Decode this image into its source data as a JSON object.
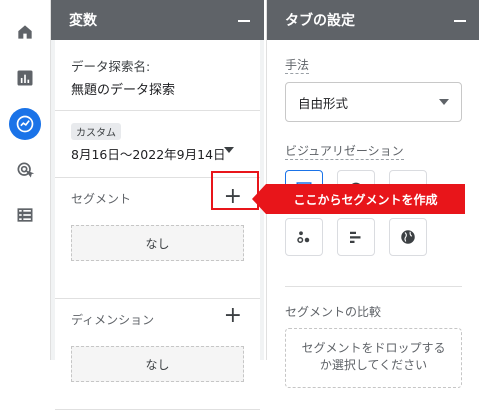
{
  "rail": {
    "items": [
      {
        "icon": "home-icon"
      },
      {
        "icon": "reports-icon"
      },
      {
        "icon": "explore-icon",
        "active": true
      },
      {
        "icon": "advertising-icon"
      },
      {
        "icon": "configure-icon"
      }
    ]
  },
  "variables": {
    "header": "変数",
    "explore_name_label": "データ探索名:",
    "explore_name_value": "無題のデータ探索",
    "date_chip": "カスタム",
    "date_range": "8月16日〜2022年9月14日",
    "segments_title": "セグメント",
    "segments_empty": "なし",
    "dimensions_title": "ディメンション",
    "dimensions_empty": "なし"
  },
  "tab_settings": {
    "header": "タブの設定",
    "technique_label": "手法",
    "technique_value": "自由形式",
    "visualization_label": "ビジュアリゼーション",
    "segment_compare_label": "セグメントの比較",
    "drop_text_line1": "セグメントをドロップする",
    "drop_text_line2": "か選択してください"
  },
  "callout": {
    "text": "ここからセグメントを作成"
  },
  "colors": {
    "header_bg": "#5f6368",
    "accent": "#1a73e8",
    "callout_red": "#e8151a"
  }
}
